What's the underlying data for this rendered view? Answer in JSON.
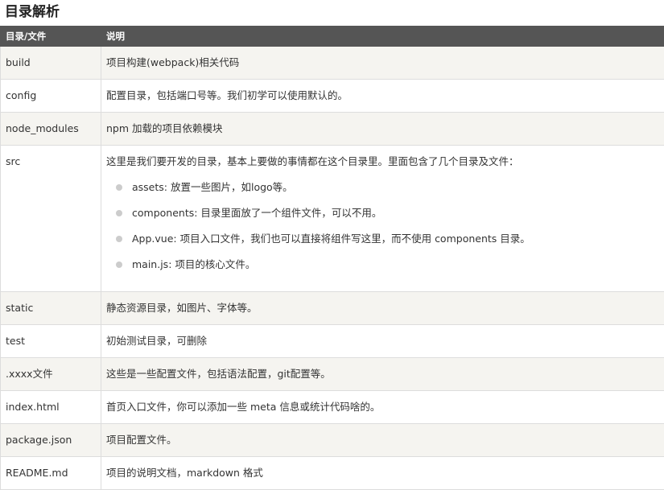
{
  "title": "目录解析",
  "table": {
    "headers": {
      "col1": "目录/文件",
      "col2": "说明"
    },
    "rows": [
      {
        "name": "build",
        "desc": "项目构建(webpack)相关代码"
      },
      {
        "name": "config",
        "desc": "配置目录，包括端口号等。我们初学可以使用默认的。"
      },
      {
        "name": "node_modules",
        "desc": "npm 加载的项目依赖模块"
      },
      {
        "name": "src",
        "desc": "这里是我们要开发的目录，基本上要做的事情都在这个目录里。里面包含了几个目录及文件：",
        "items": [
          "assets: 放置一些图片，如logo等。",
          "components: 目录里面放了一个组件文件，可以不用。",
          "App.vue: 项目入口文件，我们也可以直接将组件写这里，而不使用 components 目录。",
          "main.js: 项目的核心文件。"
        ]
      },
      {
        "name": "static",
        "desc": "静态资源目录，如图片、字体等。"
      },
      {
        "name": "test",
        "desc": "初始测试目录，可删除"
      },
      {
        "name": ".xxxx文件",
        "desc": "这些是一些配置文件，包括语法配置，git配置等。"
      },
      {
        "name": "index.html",
        "desc": "首页入口文件，你可以添加一些 meta 信息或统计代码啥的。"
      },
      {
        "name": "package.json",
        "desc": "项目配置文件。"
      },
      {
        "name": "README.md",
        "desc": "项目的说明文档，markdown 格式"
      }
    ]
  }
}
